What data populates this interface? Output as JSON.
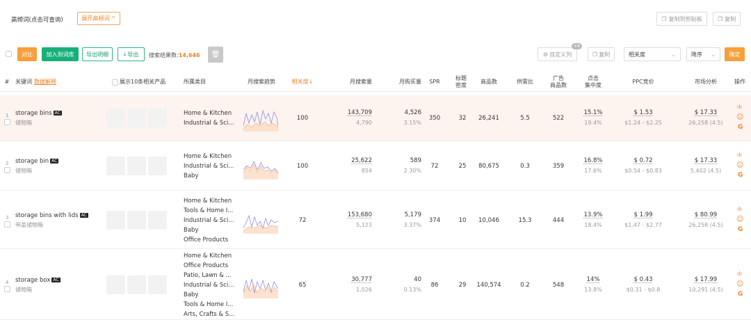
{
  "top": {
    "title": "高频词(点击可查询)",
    "expand_btn": "展开高频词 ^",
    "copy_clipboard": "复制到剪贴板",
    "copy": "复制"
  },
  "toolbar": {
    "compare": "对比",
    "add_lib": "加入到词库",
    "export_detail": "导出明细",
    "export": "导出",
    "result_label": "搜索结果数:",
    "result_count": "14,646",
    "custom_col": "自定义列",
    "custom_badge": "+4",
    "copy": "复制",
    "sort_field": "相关度",
    "sort_order": "降序",
    "confirm": "确定"
  },
  "columns": {
    "num": "#",
    "keyword": "关键词",
    "data_explain": "数据解释",
    "show10": "展示10条相关产品",
    "category": "所属类目",
    "trend": "月搜索趋势",
    "relevance": "相关度",
    "monthly_search": "月搜索量",
    "monthly_buy": "月购买量",
    "spr": "SPR",
    "title_density": "标题\n密度",
    "products": "商品数",
    "supply_ratio": "供需比",
    "ad_products": "广告\n商品数",
    "click_conc": "点击\n集中度",
    "ppc": "PPC竞价",
    "market": "市场分析",
    "ops": "操作"
  },
  "rows": [
    {
      "num": "1",
      "keyword": "storage bins",
      "ac": "AC",
      "cn": "储物箱",
      "cats": [
        "Home & Kitchen",
        "Industrial & Sci..."
      ],
      "relevance": "100",
      "search": "143,709",
      "search_sub": "4,790",
      "buy": "4,526",
      "buy_sub": "3.15%",
      "spr": "350",
      "density": "32",
      "products": "26,241",
      "ratio": "5.5",
      "ad": "522",
      "click": "15.1%",
      "click_sub": "19.4%",
      "ppc": "$ 1.53",
      "ppc_range": "$1.24 - $2.25",
      "market": "$ 17.33",
      "market_sub": "26,258 (4.5)"
    },
    {
      "num": "2",
      "keyword": "storage bin",
      "ac": "AC",
      "cn": "储物箱",
      "cats": [
        "Home & Kitchen",
        "Industrial & Sci...",
        "Baby"
      ],
      "relevance": "100",
      "search": "25,622",
      "search_sub": "854",
      "buy": "589",
      "buy_sub": "2.30%",
      "spr": "72",
      "density": "25",
      "products": "80,675",
      "ratio": "0.3",
      "ad": "359",
      "click": "16.8%",
      "click_sub": "17.6%",
      "ppc": "$ 0.72",
      "ppc_range": "$0.54 - $0.83",
      "market": "$ 17.33",
      "market_sub": "5,402 (4.5)"
    },
    {
      "num": "3",
      "keyword": "storage bins with lids",
      "ac": "AC",
      "cn": "带盖储物箱",
      "cats": [
        "Home & Kitchen",
        "Tools & Home I...",
        "Industrial & Sci...",
        "Baby",
        "Office Products"
      ],
      "relevance": "72",
      "search": "153,680",
      "search_sub": "5,123",
      "buy": "5,179",
      "buy_sub": "3.37%",
      "spr": "374",
      "density": "10",
      "products": "10,046",
      "ratio": "15.3",
      "ad": "444",
      "click": "13.9%",
      "click_sub": "18.4%",
      "ppc": "$ 1.99",
      "ppc_range": "$1.47 - $2.77",
      "market": "$ 80.99",
      "market_sub": "26,258 (4.5)"
    },
    {
      "num": "4",
      "keyword": "storage box",
      "ac": "AC",
      "cn": "储物箱",
      "cats": [
        "Home & Kitchen",
        "Office Products",
        "Patio, Lawn & ...",
        "Industrial & Sci...",
        "Baby",
        "Tools & Home I...",
        "Arts, Crafts & S..."
      ],
      "relevance": "65",
      "search": "30,777",
      "search_sub": "1,026",
      "buy": "40",
      "buy_sub": "0.13%",
      "spr": "86",
      "density": "29",
      "products": "140,574",
      "ratio": "0.2",
      "ad": "548",
      "click": "14%",
      "click_sub": "13.8%",
      "ppc": "$ 0.43",
      "ppc_range": "$0.31 - $0.8",
      "market": "$ 17.99",
      "market_sub": "10,291 (4.5)"
    }
  ],
  "colors": {
    "accent": "#f0822a",
    "green": "#17b07a",
    "row_highlight": "#fdf3ef",
    "google": "#f0822a"
  }
}
